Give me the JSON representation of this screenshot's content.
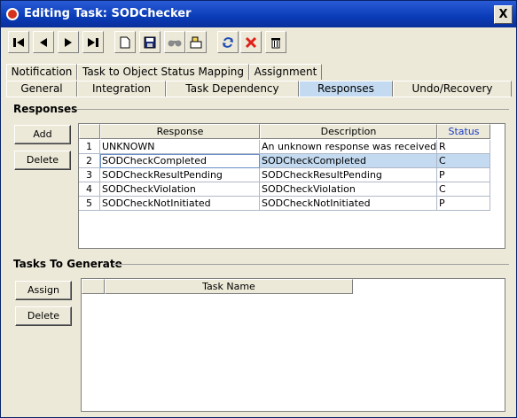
{
  "window": {
    "title": "Editing Task: SODChecker",
    "close_label": "X"
  },
  "toolbar": {
    "buttons": [
      {
        "name": "first-record-icon"
      },
      {
        "name": "previous-record-icon"
      },
      {
        "name": "next-record-icon"
      },
      {
        "name": "last-record-icon"
      },
      {
        "name": "new-icon"
      },
      {
        "name": "save-icon"
      },
      {
        "name": "find-icon"
      },
      {
        "name": "edit-icon"
      },
      {
        "name": "refresh-icon"
      },
      {
        "name": "delete-x-icon"
      },
      {
        "name": "trash-icon"
      }
    ]
  },
  "tabs": {
    "top_row": [
      "Notification",
      "Task to Object Status Mapping",
      "Assignment"
    ],
    "bottom_row": [
      "General",
      "Integration",
      "Task Dependency",
      "Responses",
      "Undo/Recovery"
    ],
    "active": "Responses"
  },
  "responses": {
    "group_title": "Responses",
    "add_label": "Add",
    "delete_label": "Delete",
    "columns": [
      "Response",
      "Description",
      "Status"
    ],
    "rows": [
      {
        "num": "1",
        "response": "UNKNOWN",
        "description": "An unknown response was received",
        "status": "R"
      },
      {
        "num": "2",
        "response": "SODCheckCompleted",
        "description": "SODCheckCompleted",
        "status": "C"
      },
      {
        "num": "3",
        "response": "SODCheckResultPending",
        "description": "SODCheckResultPending",
        "status": "P"
      },
      {
        "num": "4",
        "response": "SODCheckViolation",
        "description": "SODCheckViolation",
        "status": "C"
      },
      {
        "num": "5",
        "response": "SODCheckNotInitiated",
        "description": "SODCheckNotInitiated",
        "status": "P"
      }
    ],
    "selected_row": 2
  },
  "tasks_to_generate": {
    "group_title": "Tasks To Generate",
    "assign_label": "Assign",
    "delete_label": "Delete",
    "columns": [
      "Task Name"
    ]
  },
  "colors": {
    "title_bar": "#0a3cb8",
    "selection": "#c3daf0",
    "status_header": "#1a3cc8"
  }
}
